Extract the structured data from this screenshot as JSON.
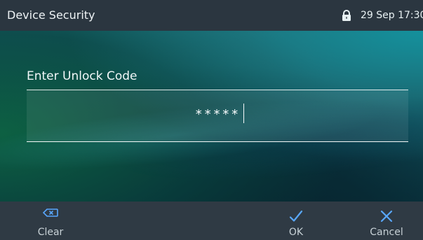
{
  "colors": {
    "header_bg": "#2b3640",
    "softkey_bg": "#2f3a44",
    "accent_blue": "#59a8ff",
    "text_light": "#eef3f5"
  },
  "header": {
    "title": "Device Security",
    "status_icon": "lock-icon",
    "datetime": "29 Sep 17:30"
  },
  "main": {
    "prompt": "Enter Unlock Code",
    "unlock_code": {
      "value": "*****"
    }
  },
  "softkeys": {
    "clear": {
      "label": "Clear",
      "icon": "backspace-icon"
    },
    "ok": {
      "label": "OK",
      "icon": "checkmark-icon"
    },
    "cancel": {
      "label": "Cancel",
      "icon": "close-icon"
    }
  }
}
